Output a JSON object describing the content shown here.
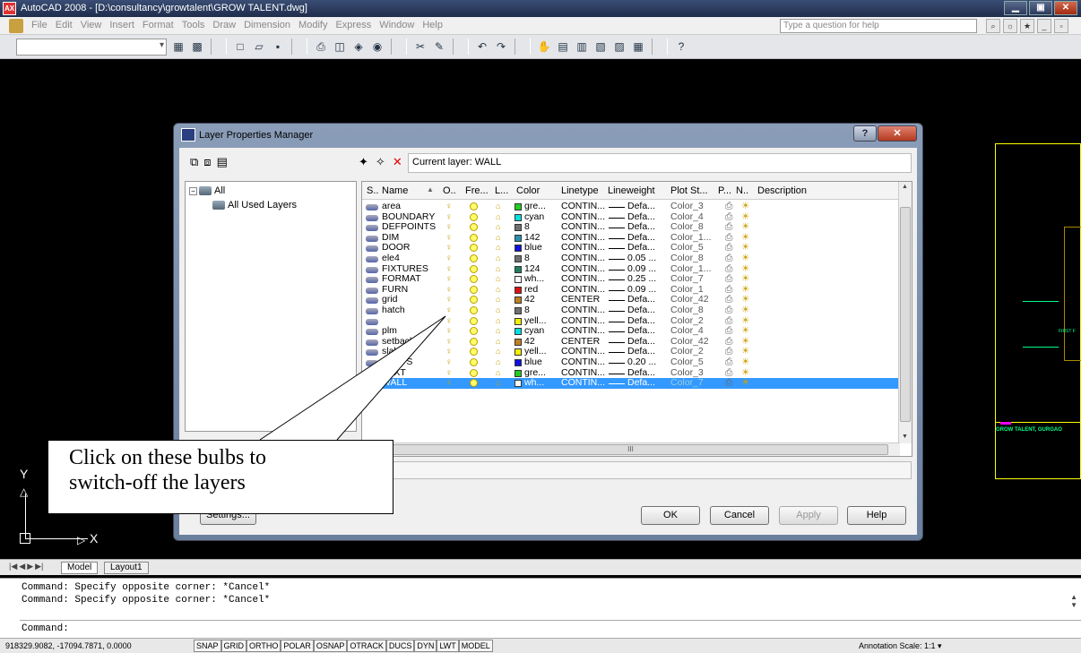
{
  "window": {
    "title": "AutoCAD 2008 - [D:\\consultancy\\growtalent\\GROW TALENT.dwg]",
    "app_icon": "AX"
  },
  "menubar": {
    "items": [
      "File",
      "Edit",
      "View",
      "Insert",
      "Format",
      "Tools",
      "Draw",
      "Dimension",
      "Modify",
      "Express",
      "Window",
      "Help"
    ],
    "question_placeholder": "Type a question for help"
  },
  "dialog": {
    "title": "Layer Properties Manager",
    "current_layer_label": "Current layer: WALL",
    "tree": {
      "root": "All",
      "child": "All Used Layers"
    },
    "columns": [
      "S..",
      "Name",
      "O..",
      "Fre...",
      "L...",
      "Color",
      "Linetype",
      "Lineweight",
      "Plot St...",
      "P...",
      "N..",
      "Description"
    ],
    "layers": [
      {
        "name": "area",
        "color": "gre...",
        "swatch": "#22cc22",
        "linetype": "CONTIN...",
        "lineweight": "Defa...",
        "plot": "Color_3"
      },
      {
        "name": "BOUNDARY",
        "color": "cyan",
        "swatch": "#00e0e0",
        "linetype": "CONTIN...",
        "lineweight": "Defa...",
        "plot": "Color_4"
      },
      {
        "name": "DEFPOINTS",
        "color": "8",
        "swatch": "#707070",
        "linetype": "CONTIN...",
        "lineweight": "Defa...",
        "plot": "Color_8"
      },
      {
        "name": "DIM",
        "color": "142",
        "swatch": "#2a8fb0",
        "linetype": "CONTIN...",
        "lineweight": "Defa...",
        "plot": "Color_1..."
      },
      {
        "name": "DOOR",
        "color": "blue",
        "swatch": "#1010e0",
        "linetype": "CONTIN...",
        "lineweight": "Defa...",
        "plot": "Color_5"
      },
      {
        "name": "ele4",
        "color": "8",
        "swatch": "#707070",
        "linetype": "CONTIN...",
        "lineweight": "0.05 ...",
        "plot": "Color_8"
      },
      {
        "name": "FIXTURES",
        "color": "124",
        "swatch": "#208060",
        "linetype": "CONTIN...",
        "lineweight": "0.09 ...",
        "plot": "Color_1..."
      },
      {
        "name": "FORMAT",
        "color": "wh...",
        "swatch": "#ffffff",
        "linetype": "CONTIN...",
        "lineweight": "0.25 ...",
        "plot": "Color_7"
      },
      {
        "name": "FURN",
        "color": "red",
        "swatch": "#e01010",
        "linetype": "CONTIN...",
        "lineweight": "0.09 ...",
        "plot": "Color_1"
      },
      {
        "name": "grid",
        "color": "42",
        "swatch": "#c08020",
        "linetype": "CENTER",
        "lineweight": "Defa...",
        "plot": "Color_42"
      },
      {
        "name": "hatch",
        "color": "8",
        "swatch": "#707070",
        "linetype": "CONTIN...",
        "lineweight": "Defa...",
        "plot": "Color_8"
      },
      {
        "name": "",
        "color": "yell...",
        "swatch": "#f0f000",
        "linetype": "CONTIN...",
        "lineweight": "Defa...",
        "plot": "Color_2"
      },
      {
        "name": "plm",
        "color": "cyan",
        "swatch": "#00e0e0",
        "linetype": "CONTIN...",
        "lineweight": "Defa...",
        "plot": "Color_4"
      },
      {
        "name": "setback",
        "color": "42",
        "swatch": "#c08020",
        "linetype": "CENTER",
        "lineweight": "Defa...",
        "plot": "Color_42"
      },
      {
        "name": "slab",
        "color": "yell...",
        "swatch": "#f0f000",
        "linetype": "CONTIN...",
        "lineweight": "Defa...",
        "plot": "Color_2"
      },
      {
        "name": "STEPS",
        "color": "blue",
        "swatch": "#1010e0",
        "linetype": "CONTIN...",
        "lineweight": "0.20 ...",
        "plot": "Color_5"
      },
      {
        "name": "TEXT",
        "color": "gre...",
        "swatch": "#22cc22",
        "linetype": "CONTIN...",
        "lineweight": "Defa...",
        "plot": "Color_3"
      },
      {
        "name": "WALL",
        "color": "wh...",
        "swatch": "#ffffff",
        "linetype": "CONTIN...",
        "lineweight": "Defa...",
        "plot": "Color_7",
        "selected": true
      }
    ],
    "buttons": {
      "settings": "Settings...",
      "ok": "OK",
      "cancel": "Cancel",
      "apply": "Apply",
      "help": "Help"
    },
    "hscroll_grip": "III"
  },
  "callout": {
    "line1": "Click on these bulbs to",
    "line2": "switch-off the layers"
  },
  "drawing": {
    "footer_label": "GROW TALENT, GURGAO",
    "floor_label": "FIRST F"
  },
  "ucs": {
    "x": "X",
    "y": "Y"
  },
  "tabs": [
    "Model",
    "Layout1"
  ],
  "commands": [
    "Command: Specify opposite corner: *Cancel*",
    "Command: Specify opposite corner: *Cancel*",
    "Command:"
  ],
  "status": {
    "coords": "918329.9082, -17094.7871, 0.0000",
    "toggles": [
      "SNAP",
      "GRID",
      "ORTHO",
      "POLAR",
      "OSNAP",
      "OTRACK",
      "DUCS",
      "DYN",
      "LWT",
      "MODEL"
    ],
    "annotation": "Annotation Scale: 1:1 ▾"
  }
}
